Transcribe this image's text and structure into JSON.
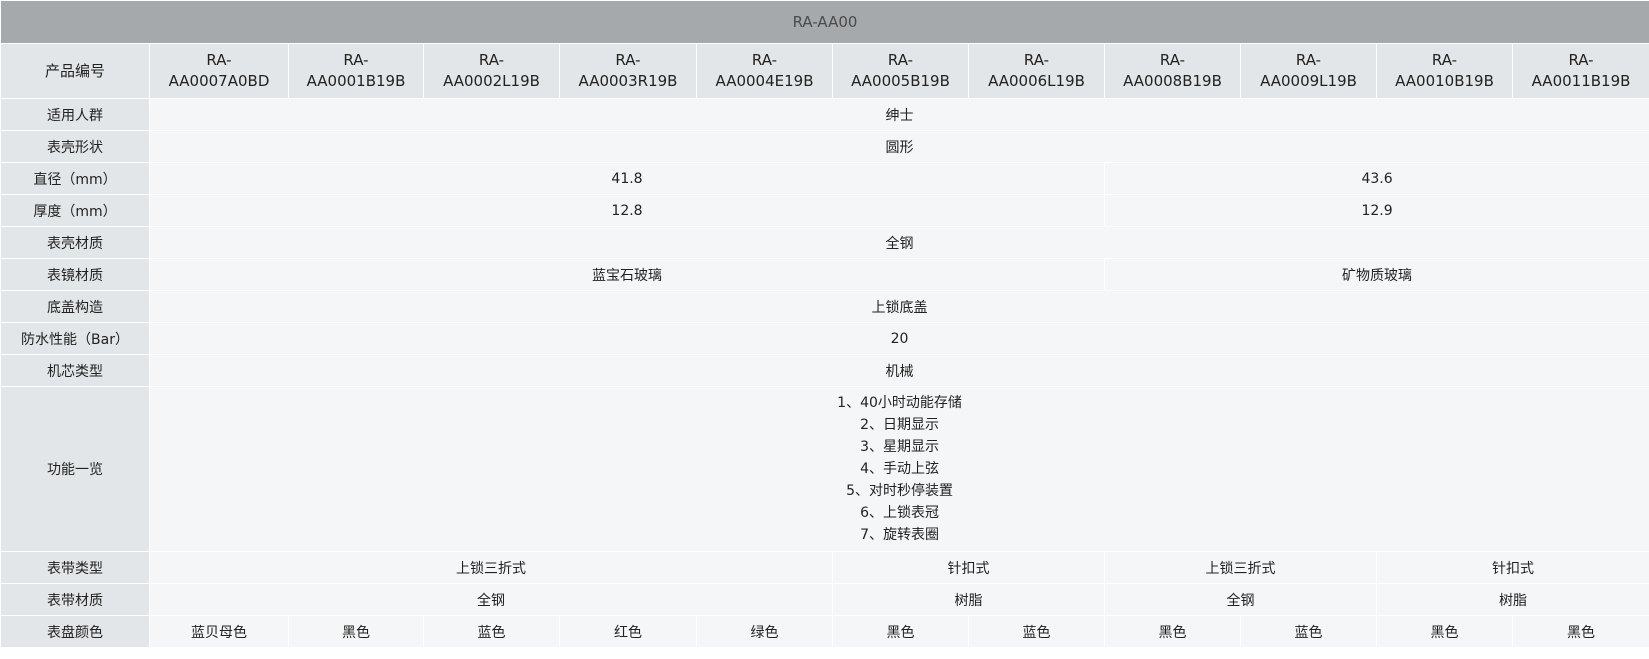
{
  "table": {
    "title": "RA-AA00",
    "model_label": "产品编号",
    "models": [
      [
        "RA-",
        "AA0007A0BD"
      ],
      [
        "RA-",
        "AA0001B19B"
      ],
      [
        "RA-",
        "AA0002L19B"
      ],
      [
        "RA-",
        "AA0003R19B"
      ],
      [
        "RA-",
        "AA0004E19B"
      ],
      [
        "RA-",
        "AA0005B19B"
      ],
      [
        "RA-",
        "AA0006L19B"
      ],
      [
        "RA-",
        "AA0008B19B"
      ],
      [
        "RA-",
        "AA0009L19B"
      ],
      [
        "RA-",
        "AA0010B19B"
      ],
      [
        "RA-",
        "AA0011B19B"
      ]
    ],
    "rows": [
      {
        "label": "适用人群",
        "values": [
          {
            "text": "绅士",
            "span": 11
          }
        ]
      },
      {
        "label": "表壳形状",
        "values": [
          {
            "text": "圆形",
            "span": 11
          }
        ]
      },
      {
        "label": "直径（mm）",
        "values": [
          {
            "text": "41.8",
            "span": 7
          },
          {
            "text": "43.6",
            "span": 4
          }
        ]
      },
      {
        "label": "厚度（mm）",
        "values": [
          {
            "text": "12.8",
            "span": 7
          },
          {
            "text": "12.9",
            "span": 4
          }
        ]
      },
      {
        "label": "表壳材质",
        "values": [
          {
            "text": "全钢",
            "span": 11
          }
        ]
      },
      {
        "label": "表镜材质",
        "values": [
          {
            "text": "蓝宝石玻璃",
            "span": 7
          },
          {
            "text": "矿物质玻璃",
            "span": 4
          }
        ]
      },
      {
        "label": "底盖构造",
        "values": [
          {
            "text": "上锁底盖",
            "span": 11
          }
        ]
      },
      {
        "label": "防水性能（Bar）",
        "values": [
          {
            "text": "20",
            "span": 11
          }
        ]
      },
      {
        "label": "机芯类型",
        "values": [
          {
            "text": "机械",
            "span": 11
          }
        ]
      }
    ],
    "functions": {
      "label": "功能一览",
      "items": [
        "1、40小时动能存储",
        "2、日期显示",
        "3、星期显示",
        "4、手动上弦",
        "5、对时秒停装置",
        "6、上锁表冠",
        "7、旋转表圈"
      ]
    },
    "rows_after": [
      {
        "label": "表带类型",
        "values": [
          {
            "text": "上锁三折式",
            "span": 5
          },
          {
            "text": "针扣式",
            "span": 2
          },
          {
            "text": "上锁三折式",
            "span": 2
          },
          {
            "text": "针扣式",
            "span": 2
          }
        ]
      },
      {
        "label": "表带材质",
        "values": [
          {
            "text": "全钢",
            "span": 5
          },
          {
            "text": "树脂",
            "span": 2
          },
          {
            "text": "全钢",
            "span": 2
          },
          {
            "text": "树脂",
            "span": 2
          }
        ]
      },
      {
        "label": "表盘颜色",
        "values": [
          {
            "text": "蓝贝母色",
            "span": 1
          },
          {
            "text": "黑色",
            "span": 1
          },
          {
            "text": "蓝色",
            "span": 1
          },
          {
            "text": "红色",
            "span": 1
          },
          {
            "text": "绿色",
            "span": 1
          },
          {
            "text": "黑色",
            "span": 1
          },
          {
            "text": "蓝色",
            "span": 1
          },
          {
            "text": "黑色",
            "span": 1
          },
          {
            "text": "蓝色",
            "span": 1
          },
          {
            "text": "黑色",
            "span": 1
          },
          {
            "text": "黑色",
            "span": 1
          }
        ]
      }
    ]
  }
}
